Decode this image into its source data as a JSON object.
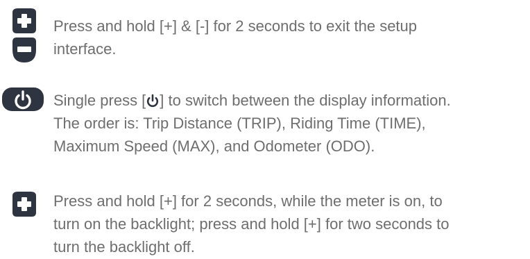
{
  "instructions": [
    {
      "icon": "plus-minus-button-icons",
      "text": "Press and hold [+] & [-] for 2 seconds to exit the setup\ninterface."
    },
    {
      "icon": "power-button-icon",
      "text_before": "Single press [",
      "inline_icon": "power-symbol-icon",
      "text_after": "] to switch between the display information.\nThe order is: Trip Distance (TRIP), Riding Time (TIME),\nMaximum Speed (MAX), and Odometer (ODO)."
    },
    {
      "icon": "plus-button-icon",
      "text": "Press and hold [+] for 2 seconds, while the meter is on, to\nturn on the backlight; press and hold [+] for two seconds to\nturn the backlight off."
    }
  ],
  "colors": {
    "icon_fill": "#2f3540",
    "icon_symbol": "#ffffff",
    "text": "#6e6e6e"
  }
}
